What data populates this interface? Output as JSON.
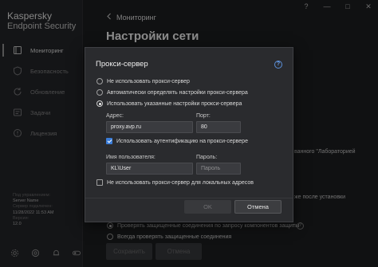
{
  "app": {
    "brand_line1": "Kaspersky",
    "brand_line2": "Endpoint Security"
  },
  "window_controls": {
    "help": "?",
    "minimize": "—",
    "maximize": "□",
    "close": "✕"
  },
  "sidebar": {
    "items": [
      {
        "label": "Мониторинг",
        "icon": "monitor-icon",
        "active": true
      },
      {
        "label": "Безопасность",
        "icon": "shield-icon",
        "active": false
      },
      {
        "label": "Обновление",
        "icon": "refresh-icon",
        "active": false
      },
      {
        "label": "Задачи",
        "icon": "tasks-icon",
        "active": false
      },
      {
        "label": "Лицензия",
        "icon": "license-icon",
        "active": false
      }
    ],
    "info": {
      "managed_label": "Под управлением:",
      "managed_value": "Server Name",
      "last_sync_label": "Сервер подключен:",
      "last_sync_value": "11/28/2022 11:53 AM",
      "version_label": "Версия:",
      "version_value": "12.0"
    }
  },
  "header": {
    "breadcrumb": "Мониторинг",
    "title": "Настройки сети"
  },
  "background": {
    "line1": "ванного \"Лабораторией",
    "line2": "же после установки",
    "radio_on": "Проверять защищенные соединения по запросу компонентов защиты",
    "radio_off": "Всегда проверять защищенные соединения",
    "save_label": "Сохранить",
    "cancel_label": "Отмена"
  },
  "dialog": {
    "title": "Прокси-сервер",
    "options": [
      {
        "label": "Не использовать прокси-сервер",
        "selected": false
      },
      {
        "label": "Автоматически определять настройки прокси-сервера",
        "selected": false
      },
      {
        "label": "Использовать указанные настройки прокси-сервера",
        "selected": true
      }
    ],
    "address_label": "Адрес:",
    "address_value": "proxy.avp.ru",
    "port_label": "Порт:",
    "port_value": "80",
    "auth_label": "Использовать аутентификацию на прокси-сервере",
    "auth_checked": true,
    "username_label": "Имя пользователя:",
    "username_value": "KL\\User",
    "password_label": "Пароль:",
    "password_placeholder": "Пароль",
    "bypass_local_label": "Не использовать прокси-сервер для локальных адресов",
    "bypass_local_checked": false,
    "ok_label": "OK",
    "cancel_label": "Отмена"
  },
  "colors": {
    "accent": "#3b7dd8",
    "background": "#1e1f21",
    "dialog": "#2a2b2e"
  }
}
